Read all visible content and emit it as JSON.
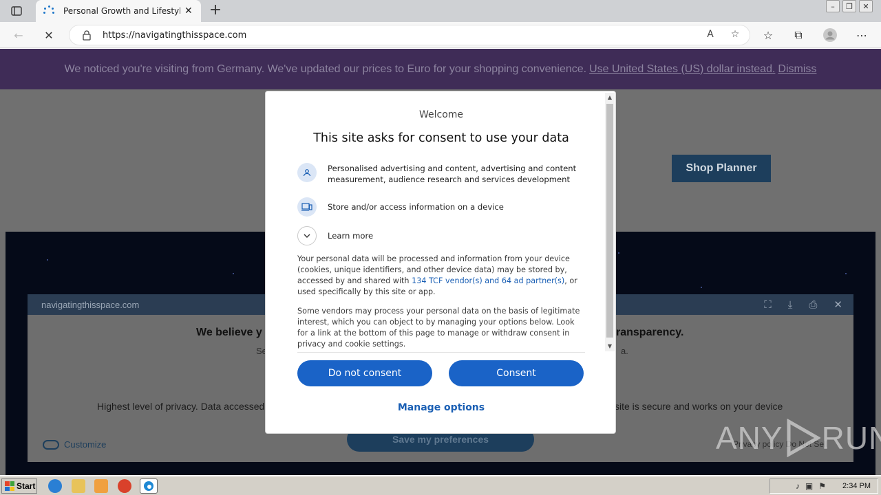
{
  "browser": {
    "tab_title": "Personal Growth and Lifestyle B",
    "new_tab": "+",
    "url": "https://navigatingthisspace.com"
  },
  "notice": {
    "text": "We noticed you're visiting from Germany. We've updated our prices to Euro for your shopping convenience.",
    "link_usd": "Use United States (US) dollar instead.",
    "link_dismiss": "Dismiss"
  },
  "site": {
    "shop_button": "Shop Planner"
  },
  "underlay": {
    "domain": "navigatingthisspace.com",
    "heading_left": "We believe y",
    "heading_right": "ransparency.",
    "small_left": "Se",
    "small_right": "a.",
    "privacy_left": "Highest level of privacy. Data accessed",
    "privacy_right": "site is secure and works on your device",
    "customize": "Customize",
    "save": "Save my preferences",
    "links": "Privacy policy  Do Not Sell"
  },
  "watermark": {
    "left": "ANY",
    "right": "RUN"
  },
  "consent": {
    "welcome": "Welcome",
    "title": "This site asks for consent to use your data",
    "purposes": [
      {
        "icon": "person-icon",
        "text": "Personalised advertising and content, advertising and content measurement, audience research and services development"
      },
      {
        "icon": "device-icon",
        "text": "Store and/or access information on a device"
      }
    ],
    "learn_more": "Learn more",
    "para1_a": "Your personal data will be processed and information from your device (cookies, unique identifiers, and other device data) may be stored by, accessed by and shared with ",
    "para1_link": "134 TCF vendor(s) and 64 ad partner(s)",
    "para1_b": ", or used specifically by this site or app.",
    "para2": "Some vendors may process your personal data on the basis of legitimate interest, which you can object to by managing your options below. Look for a link at the bottom of this page to manage or withdraw consent in privacy and cookie settings.",
    "btn_reject": "Do not consent",
    "btn_accept": "Consent",
    "manage": "Manage options"
  },
  "taskbar": {
    "start": "Start",
    "clock": "2:34 PM"
  },
  "colors": {
    "accent": "#1a63c7",
    "notice_bg": "#3f2c57",
    "hero_bg": "#050a18"
  }
}
